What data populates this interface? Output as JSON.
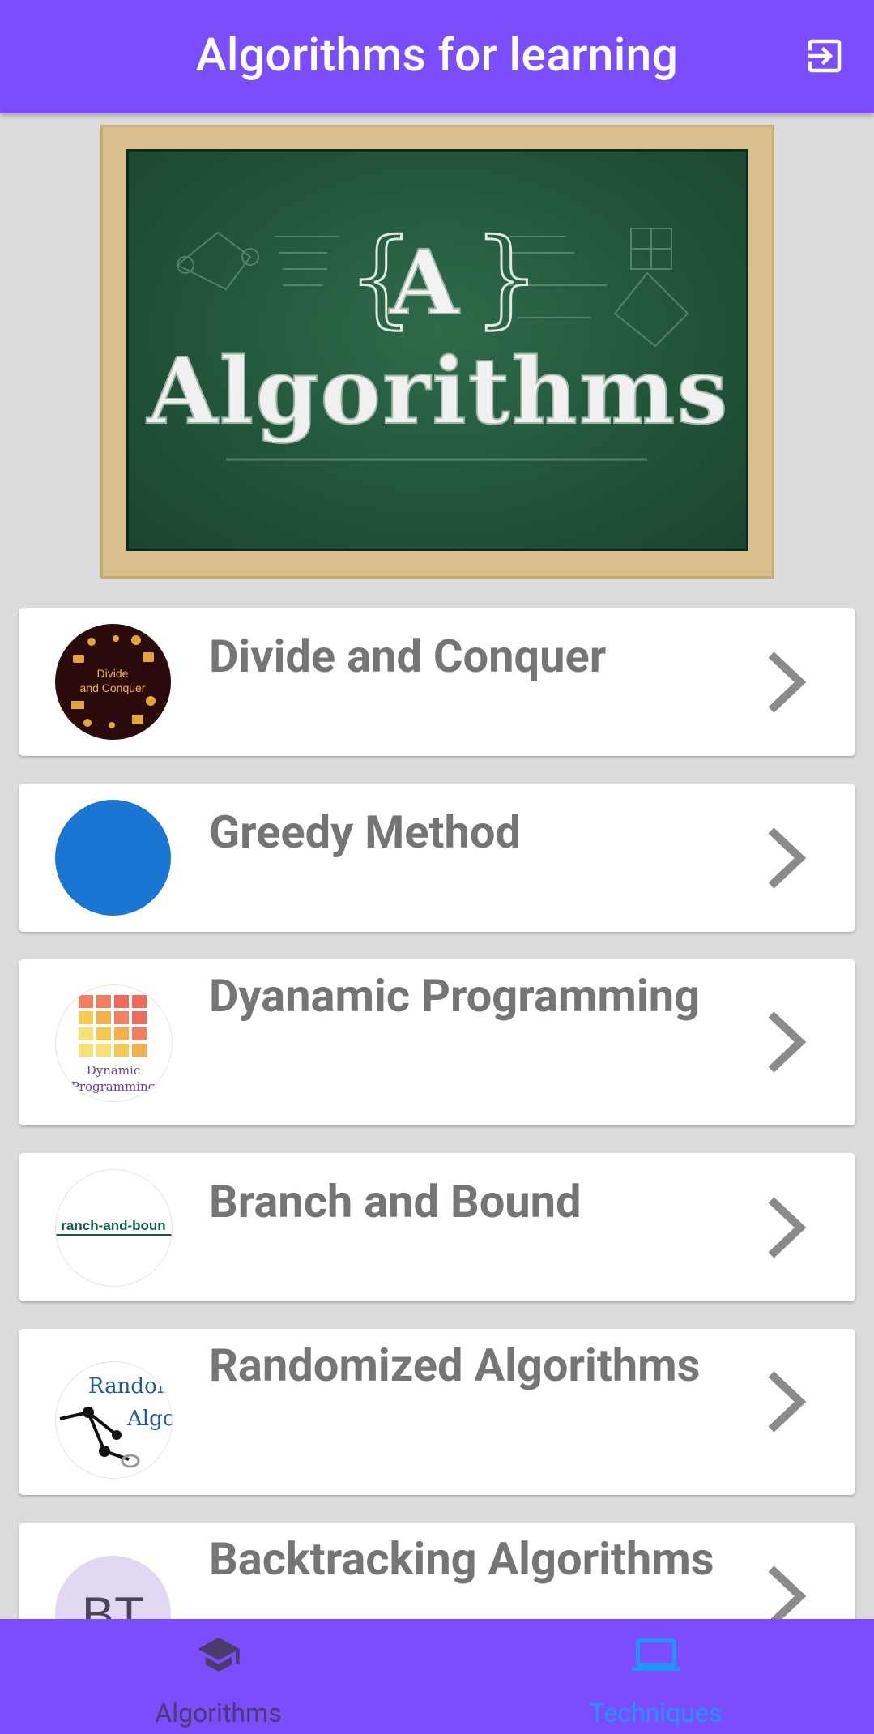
{
  "app": {
    "title": "Algorithms for learning",
    "brand_color": "#7c4dff"
  },
  "banner": {
    "image_text": "Algorithms",
    "letter": "A"
  },
  "techniques": [
    {
      "title": "Divide and Conquer",
      "avatar_text": "Divide and Conquer"
    },
    {
      "title": "Greedy Method",
      "avatar_color": "#1976d2"
    },
    {
      "title": "Dyanamic Programming",
      "avatar_text": "Dynamic Programming"
    },
    {
      "title": "Branch and Bound",
      "avatar_text": "ranch-and-boun"
    },
    {
      "title": "Randomized Algorithms",
      "avatar_text": "Randomized Algor"
    },
    {
      "title": "Backtracking Algorithms",
      "avatar_text": "BT"
    }
  ],
  "bottom_nav": {
    "items": [
      {
        "label": "Algorithms",
        "icon": "school-icon",
        "selected": false,
        "color": "#4a3b6b"
      },
      {
        "label": "Techniques",
        "icon": "laptop-icon",
        "selected": true,
        "color": "#2196f3"
      }
    ]
  }
}
